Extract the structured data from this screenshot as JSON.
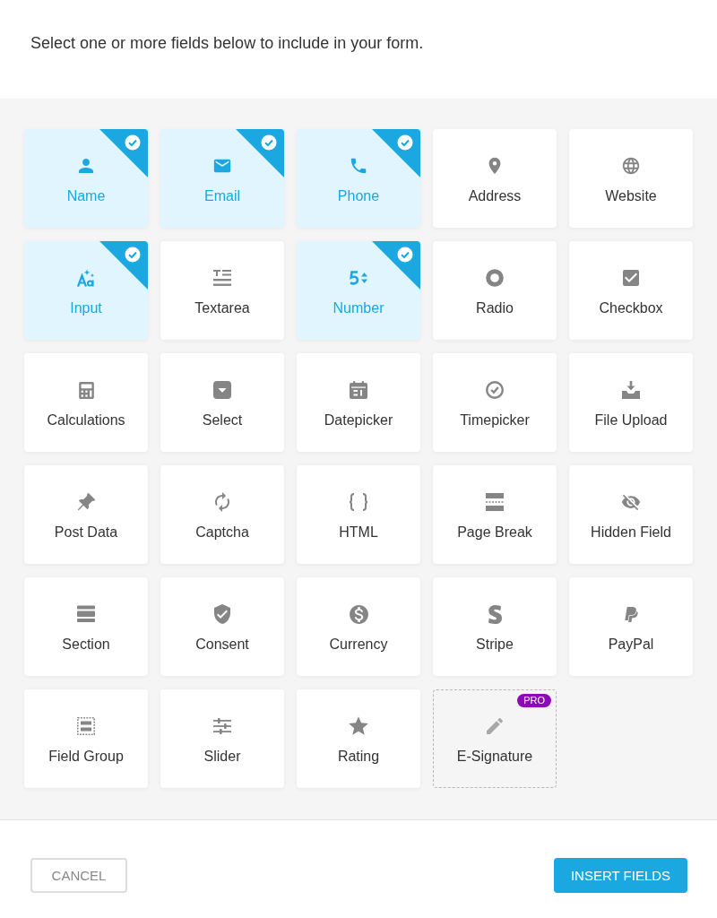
{
  "instruction": "Select one or more fields below to include in your form.",
  "fields": [
    {
      "label": "Name",
      "selected": true,
      "locked": false
    },
    {
      "label": "Email",
      "selected": true,
      "locked": false
    },
    {
      "label": "Phone",
      "selected": true,
      "locked": false
    },
    {
      "label": "Address",
      "selected": false,
      "locked": false
    },
    {
      "label": "Website",
      "selected": false,
      "locked": false
    },
    {
      "label": "Input",
      "selected": true,
      "locked": false
    },
    {
      "label": "Textarea",
      "selected": false,
      "locked": false
    },
    {
      "label": "Number",
      "selected": true,
      "locked": false
    },
    {
      "label": "Radio",
      "selected": false,
      "locked": false
    },
    {
      "label": "Checkbox",
      "selected": false,
      "locked": false
    },
    {
      "label": "Calculations",
      "selected": false,
      "locked": false
    },
    {
      "label": "Select",
      "selected": false,
      "locked": false
    },
    {
      "label": "Datepicker",
      "selected": false,
      "locked": false
    },
    {
      "label": "Timepicker",
      "selected": false,
      "locked": false
    },
    {
      "label": "File Upload",
      "selected": false,
      "locked": false
    },
    {
      "label": "Post Data",
      "selected": false,
      "locked": false
    },
    {
      "label": "Captcha",
      "selected": false,
      "locked": false
    },
    {
      "label": "HTML",
      "selected": false,
      "locked": false
    },
    {
      "label": "Page Break",
      "selected": false,
      "locked": false
    },
    {
      "label": "Hidden Field",
      "selected": false,
      "locked": false
    },
    {
      "label": "Section",
      "selected": false,
      "locked": false
    },
    {
      "label": "Consent",
      "selected": false,
      "locked": false
    },
    {
      "label": "Currency",
      "selected": false,
      "locked": false
    },
    {
      "label": "Stripe",
      "selected": false,
      "locked": false
    },
    {
      "label": "PayPal",
      "selected": false,
      "locked": false
    },
    {
      "label": "Field Group",
      "selected": false,
      "locked": false
    },
    {
      "label": "Slider",
      "selected": false,
      "locked": false
    },
    {
      "label": "Rating",
      "selected": false,
      "locked": false
    },
    {
      "label": "E-Signature",
      "selected": false,
      "locked": true,
      "badge": "PRO"
    }
  ],
  "buttons": [
    {
      "kind": "cancel",
      "label": "CANCEL"
    },
    {
      "kind": "primary",
      "label": "INSERT FIELDS"
    }
  ]
}
